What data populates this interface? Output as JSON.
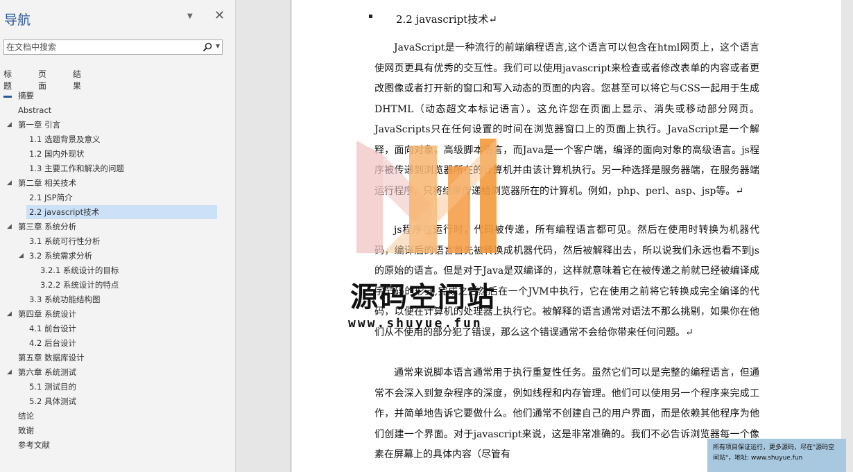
{
  "nav": {
    "title": "导航",
    "search_placeholder": "在文档中搜索",
    "tabs": [
      "标题",
      "页面",
      "结果"
    ],
    "items": [
      {
        "label": "摘要",
        "level": 1,
        "twisty": false
      },
      {
        "label": "Abstract",
        "level": 1,
        "twisty": false
      },
      {
        "label": "第一章 引言",
        "level": 1,
        "twisty": true
      },
      {
        "label": "1.1 选题背景及意义",
        "level": 2,
        "twisty": false
      },
      {
        "label": "1.2 国内外现状",
        "level": 2,
        "twisty": false
      },
      {
        "label": "1.3 主要工作和解决的问题",
        "level": 2,
        "twisty": false
      },
      {
        "label": "第二章 相关技术",
        "level": 1,
        "twisty": true
      },
      {
        "label": "2.1 JSP简介",
        "level": 2,
        "twisty": false
      },
      {
        "label": "2.2 javascript技术",
        "level": 2,
        "twisty": false,
        "selected": true
      },
      {
        "label": "第三章 系统分析",
        "level": 1,
        "twisty": true
      },
      {
        "label": "3.1 系统可行性分析",
        "level": 2,
        "twisty": false
      },
      {
        "label": "3.2 系统需求分析",
        "level": 2,
        "twisty": true
      },
      {
        "label": "3.2.1 系统设计的目标",
        "level": 3,
        "twisty": false
      },
      {
        "label": "3.2.2 系统设计的特点",
        "level": 3,
        "twisty": false
      },
      {
        "label": "3.3 系统功能结构图",
        "level": 2,
        "twisty": false
      },
      {
        "label": "第四章 系统设计",
        "level": 1,
        "twisty": true
      },
      {
        "label": "4.1 前台设计",
        "level": 2,
        "twisty": false
      },
      {
        "label": "4.2 后台设计",
        "level": 2,
        "twisty": false
      },
      {
        "label": "第五章 数据库设计",
        "level": 1,
        "twisty": false
      },
      {
        "label": "第六章 系统测试",
        "level": 1,
        "twisty": true
      },
      {
        "label": "5.1 测试目的",
        "level": 2,
        "twisty": false
      },
      {
        "label": "5.2 具体测试",
        "level": 2,
        "twisty": false
      },
      {
        "label": "结论",
        "level": 1,
        "twisty": false
      },
      {
        "label": "致谢",
        "level": 1,
        "twisty": false
      },
      {
        "label": "参考文献",
        "level": 1,
        "twisty": false
      }
    ]
  },
  "document": {
    "heading": "2.2 javascript技术↵",
    "paragraphs": [
      "JavaScript是一种流行的前端编程语言,这个语言可以包含在html网页上，这个语言使网页更具有优秀的交互性。我们可以使用javascript来检查或者修改表单的内容或者更改图像或者打开新的窗口和写入动态的页面的内容。您甚至可以将它与CSS一起用于生成DHTML（动态超文本标记语言）。这允许您在页面上显示、消失或移动部分网页。JavaScripts只在任何设置的时间在浏览器窗口上的页面上执行。JavaScript是一个解释，面向对象，高级脚本语言，而Java是一个客户端，编译的面向对象的高级语言。js程序被传递到浏览器所在的计算机并由该计算机执行。另一种选择是服务器端，在服务器端运行程序，只将结果传递给浏览器所在的计算机。例如，php、perl、asp、jsp等。↵",
      "js程序在运行时，代码被传递，所有编程语言都可见。然后在使用时转换为机器代码，编译后的语言首先被转换成机器代码，然后被解释出去，所以说我们永远也看不到js的原始的语言。但是对于Java是双编译的，这样就意味着它在被传递之前就已经被编译成字节码的形式,完成之后然后在一个JVM中执行，它在使用之前将它转换成完全编译的代码，以便在计算机的处理器上执行它。被解释的语言通常对语法不那么挑剔，如果你在他们从不使用的部分犯了错误，那么这个错误通常不会给你带来任何问题。↵",
      "通常来说脚本语言通常用于执行重复性任务。虽然它们可以是完整的编程语言，但通常不会深入到复杂程序的深度，例如线程和内存管理。他们可以使用另一个程序来完成工作，并简单地告诉它要做什么。他们通常不创建自己的用户界面，而是依赖其他程序为他们创建一个界面。对于javascript来说，这是非常准确的。我们不必告诉浏览器每一个像素在屏幕上的具体内容（尽管有"
    ]
  },
  "watermark": {
    "text": "源码空间站",
    "url": "www.shuyue.fun"
  },
  "notice": {
    "text": "所有项目保证运行，更多源码，尽在\"源码空间站\"，地址: www.shuyue.fun"
  },
  "colors": {
    "accent": "#2b579a",
    "selected_bg": "#cce0f7",
    "watermark_orange": "#f5a04a",
    "watermark_pink": "#f2c4c4",
    "notice_bg": "#a8c8e0"
  }
}
